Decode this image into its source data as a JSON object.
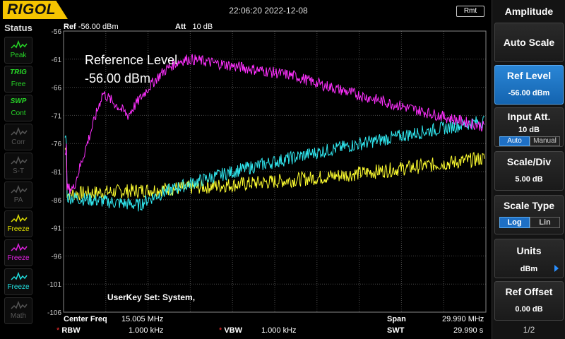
{
  "header": {
    "logo": "RIGOL",
    "datetime": "22:06:20 2022-12-08",
    "remote_badge": "Rmt"
  },
  "status_panel": {
    "title": "Status",
    "items": [
      {
        "label": "Peak",
        "icon": "peak-icon",
        "color": "#27d527"
      },
      {
        "label": "Free",
        "top": "TRIG",
        "icon": "trig-icon",
        "color": "#27d527"
      },
      {
        "label": "Cont",
        "top": "SWP",
        "icon": "sweep-icon",
        "color": "#27d527"
      },
      {
        "label": "Corr",
        "icon": "corr-icon",
        "color": "#555555"
      },
      {
        "label": "S-T",
        "icon": "source-tracking-icon",
        "color": "#555555"
      },
      {
        "label": "PA",
        "icon": "preamp-icon",
        "color": "#555555"
      },
      {
        "label": "Freeze",
        "icon": "trace1-icon",
        "color": "#e0e000"
      },
      {
        "label": "Freeze",
        "icon": "trace2-icon",
        "color": "#e020e0"
      },
      {
        "label": "Freeze",
        "icon": "trace3-icon",
        "color": "#20e0e0"
      },
      {
        "label": "Math",
        "icon": "math-icon",
        "color": "#555555"
      }
    ]
  },
  "plot": {
    "ref_label": "Ref",
    "ref_value": "-56.00 dBm",
    "att_label": "Att",
    "att_value": "10 dB",
    "y_ticks": [
      "-56",
      "-61",
      "-66",
      "-71",
      "-76",
      "-81",
      "-86",
      "-91",
      "-96",
      "-101",
      "-106"
    ],
    "reference_note_line1": "Reference Level",
    "reference_note_line2": "-56.00 dBm",
    "userkey": "UserKey Set:    System,",
    "trace_colors": {
      "trace1": "#ffff30",
      "trace2": "#ff30ff",
      "trace3": "#30e8f0"
    }
  },
  "footer": {
    "center_label": "Center Freq",
    "center_value": "15.005 MHz",
    "span_label": "Span",
    "span_value": "29.990 MHz",
    "rbw_label": "RBW",
    "rbw_value": "1.000 kHz",
    "vbw_label": "VBW",
    "vbw_value": "1.000 kHz",
    "swt_label": "SWT",
    "swt_value": "29.990 s",
    "star": "*"
  },
  "menu": {
    "title": "Amplitude",
    "auto_scale": "Auto Scale",
    "ref_level_label": "Ref Level",
    "ref_level_value": "-56.00 dBm",
    "input_att_label": "Input Att.",
    "input_att_value": "10 dB",
    "att_auto": "Auto",
    "att_manual": "Manual",
    "scale_div_label": "Scale/Div",
    "scale_div_value": "5.00 dB",
    "scale_type_label": "Scale Type",
    "scale_log": "Log",
    "scale_lin": "Lin",
    "units_label": "Units",
    "units_value": "dBm",
    "ref_offset_label": "Ref Offset",
    "ref_offset_value": "0.00 dB",
    "page": "1/2"
  }
}
